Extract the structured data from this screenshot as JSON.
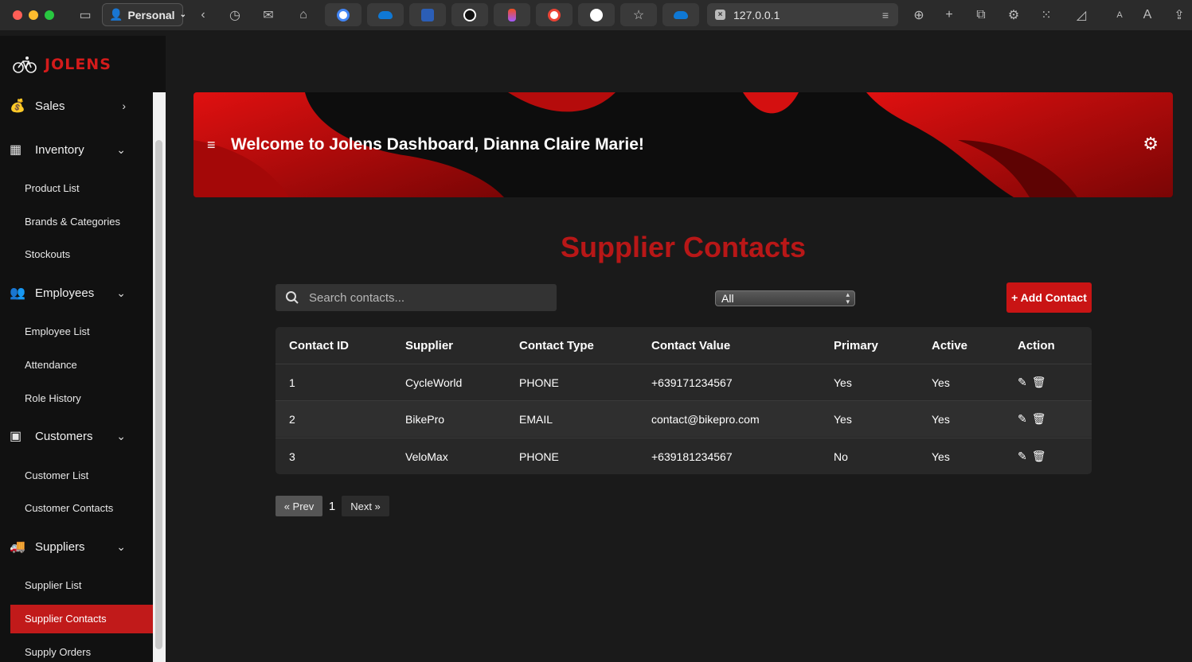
{
  "browser": {
    "profile": "Personal",
    "url": "127.0.0.1"
  },
  "sidebar": {
    "brand": "JOLENS",
    "sections": [
      {
        "label": "Sales",
        "icon": "money-bag-icon",
        "chevron": ">"
      },
      {
        "label": "Inventory",
        "icon": "boxes-icon",
        "chevron": "v",
        "items": [
          "Product List",
          "Brands & Categories",
          "Stockouts"
        ]
      },
      {
        "label": "Employees",
        "icon": "users-icon",
        "chevron": "v",
        "items": [
          "Employee List",
          "Attendance",
          "Role History"
        ]
      },
      {
        "label": "Customers",
        "icon": "address-card-icon",
        "chevron": "v",
        "items": [
          "Customer List",
          "Customer Contacts"
        ]
      },
      {
        "label": "Suppliers",
        "icon": "truck-icon",
        "chevron": "v",
        "items": [
          "Supplier List",
          "Supplier Contacts",
          "Supply Orders"
        ]
      }
    ],
    "active_item": "Supplier Contacts"
  },
  "header": {
    "welcome": "Welcome to Jolens Dashboard, Dianna Claire Marie!"
  },
  "page": {
    "title": "Supplier Contacts",
    "search_placeholder": "Search contacts...",
    "filter_value": "All",
    "add_button": "+ Add Contact"
  },
  "table": {
    "columns": [
      "Contact ID",
      "Supplier",
      "Contact Type",
      "Contact Value",
      "Primary",
      "Active",
      "Action"
    ],
    "rows": [
      [
        "1",
        "CycleWorld",
        "PHONE",
        "+639171234567",
        "Yes",
        "Yes"
      ],
      [
        "2",
        "BikePro",
        "EMAIL",
        "contact@bikepro.com",
        "Yes",
        "Yes"
      ],
      [
        "3",
        "VeloMax",
        "PHONE",
        "+639181234567",
        "No",
        "Yes"
      ]
    ]
  },
  "pagination": {
    "prev": "« Prev",
    "current": "1",
    "next": "Next »"
  },
  "colors": {
    "accent": "#c91414",
    "title_red": "#b81717",
    "background": "#1a1a1a"
  }
}
